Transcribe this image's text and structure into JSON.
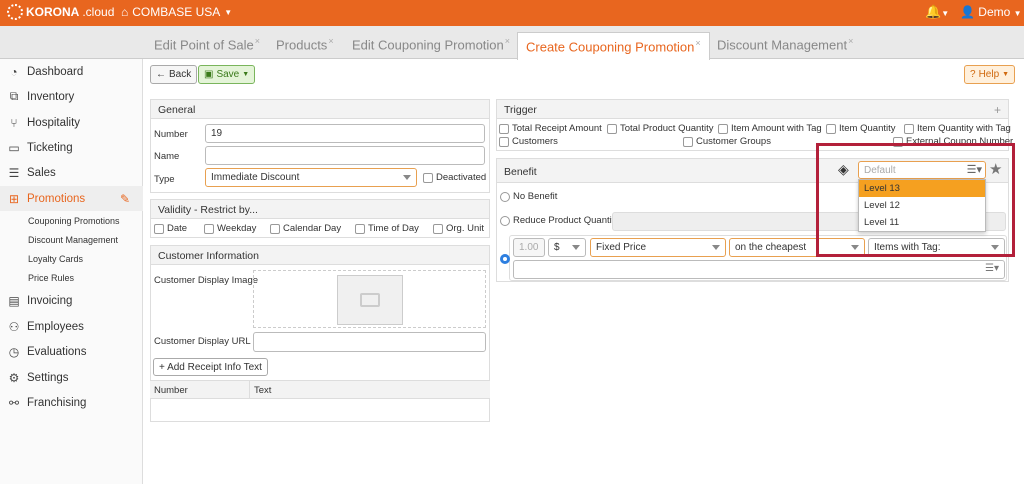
{
  "app": {
    "brand": "KORONA",
    "brand_suffix": ".cloud",
    "company": "COMBASE USA",
    "user": "Demo",
    "accent": "#e8661f"
  },
  "tabs": [
    {
      "label": "Edit Point of Sale"
    },
    {
      "label": "Products"
    },
    {
      "label": "Edit Couponing Promotion"
    },
    {
      "label": "Create Couponing Promotion"
    },
    {
      "label": "Discount Management"
    }
  ],
  "sidebar": {
    "items": [
      {
        "label": "Dashboard",
        "icon": "dashboard-icon"
      },
      {
        "label": "Inventory",
        "icon": "inventory-icon"
      },
      {
        "label": "Hospitality",
        "icon": "hospitality-icon"
      },
      {
        "label": "Ticketing",
        "icon": "ticket-icon"
      },
      {
        "label": "Sales",
        "icon": "sales-icon"
      },
      {
        "label": "Promotions",
        "icon": "gift-icon"
      },
      {
        "label": "Invoicing",
        "icon": "invoice-icon"
      },
      {
        "label": "Employees",
        "icon": "employees-icon"
      },
      {
        "label": "Evaluations",
        "icon": "chart-icon"
      },
      {
        "label": "Settings",
        "icon": "gear-icon"
      },
      {
        "label": "Franchising",
        "icon": "handshake-icon"
      }
    ],
    "subitems": [
      {
        "label": "Couponing Promotions"
      },
      {
        "label": "Discount Management"
      },
      {
        "label": "Loyalty Cards"
      },
      {
        "label": "Price Rules"
      }
    ]
  },
  "toolbar": {
    "back": "Back",
    "save": "Save",
    "help": "Help"
  },
  "general": {
    "title": "General",
    "number_label": "Number",
    "number_value": "19",
    "name_label": "Name",
    "name_value": "",
    "type_label": "Type",
    "type_value": "Immediate Discount",
    "deactivated": "Deactivated"
  },
  "validity": {
    "title": "Validity - Restrict by...",
    "options": [
      "Date",
      "Weekday",
      "Calendar Day",
      "Time of Day",
      "Org. Unit"
    ]
  },
  "customer_info": {
    "title": "Customer Information",
    "image_label": "Customer Display Image",
    "url_label": "Customer Display URL",
    "add_button": "+ Add Receipt Info Text",
    "col_number": "Number",
    "col_text": "Text"
  },
  "trigger": {
    "title": "Trigger",
    "options": [
      "Total Receipt Amount",
      "Total Product Quantity",
      "Item Amount with Tag",
      "Item Quantity",
      "Item Quantity with Tag",
      "Customers",
      "Customer Groups",
      "External Coupon Number"
    ]
  },
  "benefit": {
    "title": "Benefit",
    "level_placeholder": "Default",
    "level_options": [
      "Level 13",
      "Level 12",
      "Level 11"
    ],
    "no_benefit": "No Benefit",
    "reduce_qty": "Reduce Product Quantity",
    "amount": "1.00",
    "currency": "$",
    "price_type": "Fixed Price",
    "target": "on the cheapest",
    "items_with": "Items with Tag:"
  }
}
